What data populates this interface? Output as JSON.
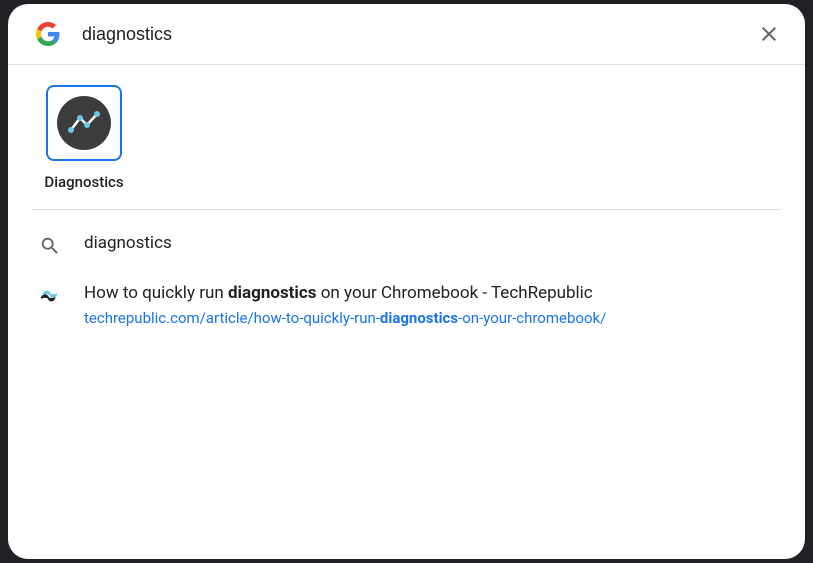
{
  "search": {
    "value": "diagnostics"
  },
  "apps": [
    {
      "label": "Diagnostics"
    }
  ],
  "results": {
    "query": {
      "text": "diagnostics"
    },
    "web": {
      "title_pre": "How to quickly run ",
      "title_bold": "diagnostics",
      "title_post": " on your Chromebook - TechRepublic",
      "url_pre": "techrepublic.com/article/how-to-quickly-run-",
      "url_bold": "diagnostics",
      "url_post": "-on-your-chromebook/"
    }
  }
}
